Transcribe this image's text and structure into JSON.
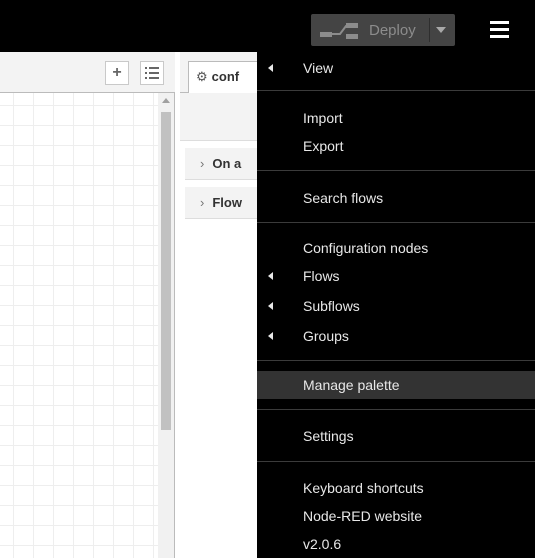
{
  "header": {
    "deploy_label": "Deploy"
  },
  "sidebar": {
    "tab_label": "conf",
    "sections": [
      "On a",
      "Flow"
    ]
  },
  "menu": {
    "items": [
      {
        "label": "View",
        "submenu": true
      },
      {
        "label": "Import",
        "submenu": false
      },
      {
        "label": "Export",
        "submenu": false
      },
      {
        "label": "Search flows",
        "submenu": false
      },
      {
        "label": "Configuration nodes",
        "submenu": false
      },
      {
        "label": "Flows",
        "submenu": true
      },
      {
        "label": "Subflows",
        "submenu": true
      },
      {
        "label": "Groups",
        "submenu": true
      },
      {
        "label": "Manage palette",
        "submenu": false,
        "highlighted": true
      },
      {
        "label": "Settings",
        "submenu": false
      },
      {
        "label": "Keyboard shortcuts",
        "submenu": false
      },
      {
        "label": "Node-RED website",
        "submenu": false
      },
      {
        "label": "v2.0.6",
        "submenu": false
      }
    ]
  },
  "icons": {
    "add": "+",
    "list": "list-icon",
    "gear": "⚙",
    "menu": "hamburger-icon",
    "deploy": "deploy-icon"
  },
  "colors": {
    "header_bg": "#000000",
    "menu_bg": "#000000",
    "menu_highlight": "#333333",
    "deploy_bg": "#444444"
  }
}
